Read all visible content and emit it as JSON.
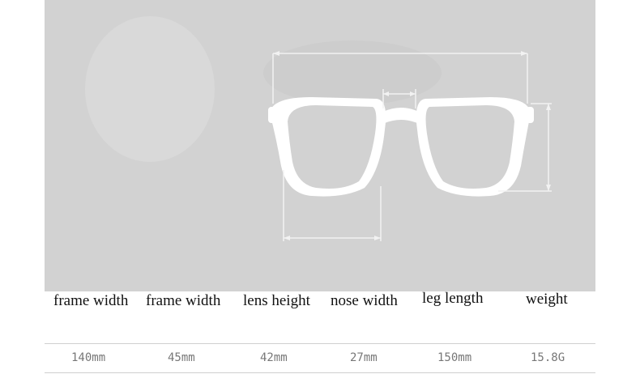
{
  "colors": {
    "photo_background": "#d2d2d2",
    "frame": "#ffffff",
    "label_text": "#111111",
    "value_text": "#777777"
  },
  "photo": {
    "subject_icon": "glasses-icon"
  },
  "spec_labels": [
    "frame width",
    "frame width",
    "lens height",
    "nose width",
    "leg length",
    "weight"
  ],
  "spec_values": [
    "140mm",
    "45mm",
    "42mm",
    "27mm",
    "150mm",
    "15.8G"
  ]
}
